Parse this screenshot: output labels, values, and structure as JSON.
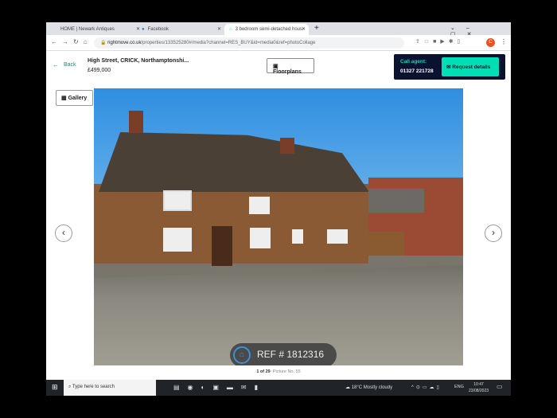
{
  "browser": {
    "tabs": [
      {
        "label": "HOME | Newark Antiques"
      },
      {
        "label": "Facebook"
      },
      {
        "label": "3 bedroom semi-detached hous"
      }
    ],
    "url_domain": "rightmove.co.uk",
    "url_path": "/properties/133525280#/media?channel=RES_BUY&id=media0&ref=photoCollage"
  },
  "header": {
    "back": "Back",
    "address": "High Street, CRICK, Northamptonshi...",
    "price": "£499,000",
    "floorplans": "Floorplans",
    "call_agent": "Call agent:",
    "phone": "01327 221728",
    "request": "Request details"
  },
  "gallery": {
    "button": "Gallery",
    "counter": "1 of 29",
    "caption": "Picture No. 55",
    "watermark": "REF # 1812316"
  },
  "taskbar": {
    "search_placeholder": "Type here to search",
    "weather": "18°C  Mostly cloudy",
    "lang": "ENG",
    "time": "10:47",
    "date": "23/08/2023"
  },
  "colors": {
    "accent": "#00deb6",
    "agent_bg": "#0a1230"
  }
}
